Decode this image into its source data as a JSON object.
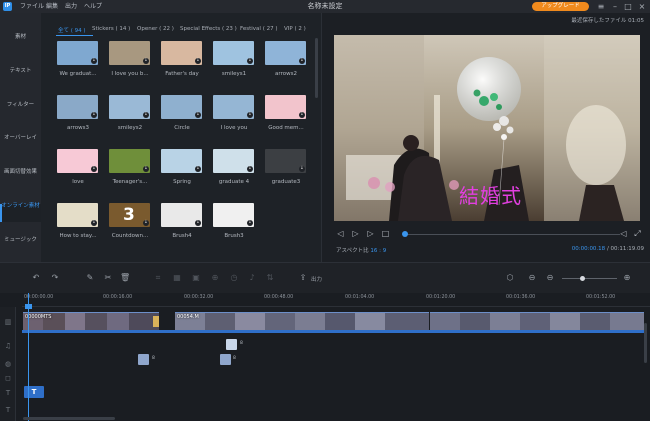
{
  "menu": {
    "app_logo": "IP",
    "items": [
      "ファイル",
      "編集",
      "出力",
      "ヘルプ"
    ],
    "window_title": "名称未設定",
    "upgrade": "アップグレード"
  },
  "sidebar": {
    "items": [
      "素材",
      "テキスト",
      "フィルター",
      "オーバーレイ",
      "画面切替効果",
      "オンライン素材",
      "ミュージック"
    ]
  },
  "media": {
    "tabs": [
      "全て ( 94 )",
      "Stickers ( 14 )",
      "Opener ( 22 )",
      "Special Effects ( 23 )",
      "Festival ( 27 )",
      "VIP ( 2 )"
    ],
    "items": [
      {
        "label": "We graduat...",
        "color": "#7fa8d0"
      },
      {
        "label": "I love you b...",
        "color": "#a89880"
      },
      {
        "label": "Father's day",
        "color": "#d8b8a0"
      },
      {
        "label": "smileys1",
        "color": "#9fc3e0"
      },
      {
        "label": "arrows2",
        "color": "#8fb4d8"
      },
      {
        "label": "arrows3",
        "color": "#8aa9c8"
      },
      {
        "label": "smileys2",
        "color": "#9ab9d6"
      },
      {
        "label": "Circle",
        "color": "#8fb0cf"
      },
      {
        "label": "I love you",
        "color": "#95b6d4"
      },
      {
        "label": "Good mem...",
        "color": "#f2c4cc"
      },
      {
        "label": "love",
        "color": "#f7c9d6"
      },
      {
        "label": "Teenager's...",
        "color": "#6f8f3a"
      },
      {
        "label": "Spring",
        "color": "#b9d3e6"
      },
      {
        "label": "graduate 4",
        "color": "#cfe0ea"
      },
      {
        "label": "graduate3",
        "color": "#3c3f43"
      },
      {
        "label": "How to stay...",
        "color": "#e4ddc8"
      },
      {
        "label": "Countdown...",
        "color": "#7a5a2e"
      },
      {
        "label": "Brush4",
        "color": "#e9e9e9"
      },
      {
        "label": "Brush3",
        "color": "#f0f0f0"
      }
    ],
    "countdown_number": "3"
  },
  "preview": {
    "recent": "最近保存したファイル 01:05",
    "video_text": "結婚式",
    "aspect_label": "アスペクト比",
    "aspect_value": "16 : 9",
    "time_current": "00:00:00.18",
    "time_total": "00:11:19.09"
  },
  "toolbar": {
    "export_label": "出力"
  },
  "timeline": {
    "ticks": [
      "00:00:00.00",
      "00:00:16.00",
      "00:00:32.00",
      "00:00:48.00",
      "00:01:04.00",
      "00:01:20.00",
      "00:01:36.00",
      "00:01:52.00"
    ],
    "clips": [
      "00000MTS",
      "00054.M",
      ""
    ],
    "fx_counts": [
      "8",
      "8",
      "8"
    ],
    "text_clip": "T"
  },
  "colors": {
    "accent": "#3a95ee",
    "upgrade": "#f08a1d",
    "video_text": "#e23fe0"
  }
}
